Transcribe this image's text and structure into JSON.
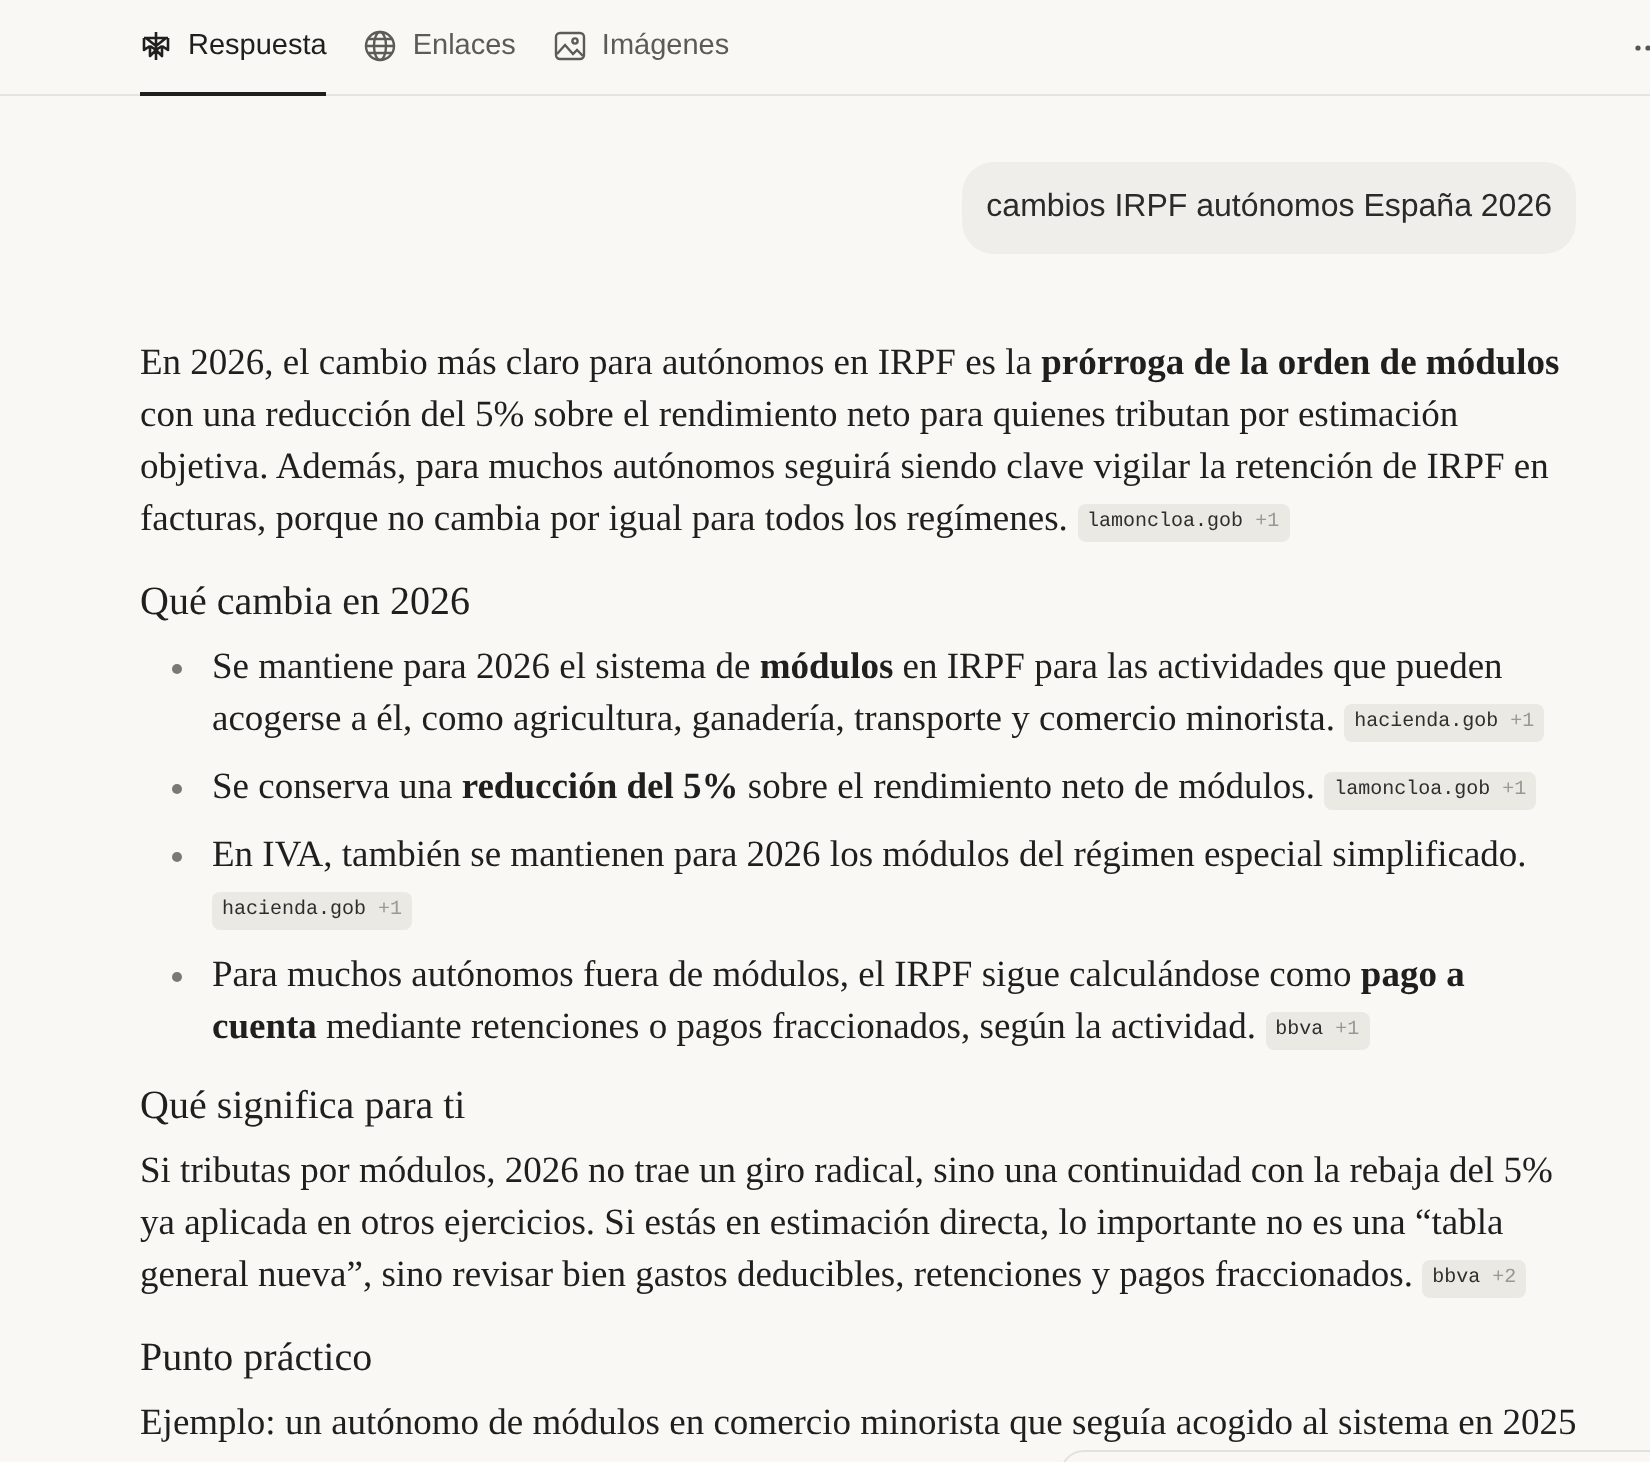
{
  "tabs": [
    {
      "label": "Respuesta",
      "selected": true
    },
    {
      "label": "Enlaces",
      "selected": false
    },
    {
      "label": "Imágenes",
      "selected": false
    }
  ],
  "query": {
    "text": "cambios IRPF autónomos España 2026"
  },
  "answer": [
    {
      "kind": "paragraph",
      "text": "En 2026, el cambio más claro para autónomos en IRPF es la **prórroga de la orden de módulos** con una reducción del 5% sobre el rendimiento neto para quienes tributan por estimación objetiva. Además, para muchos autónomos seguirá siendo clave vigilar la retención de IRPF en facturas, porque no cambia por igual para todos los regímenes.",
      "citation": {
        "source": "lamoncloa.gob",
        "count": "+1"
      }
    },
    {
      "kind": "heading",
      "text": "Qué cambia en 2026"
    },
    {
      "kind": "list",
      "items": [
        {
          "text": "Se mantiene para 2026 el sistema de **módulos** en IRPF para las actividades que pueden acogerse a él, como agricultura, ganadería, transporte y comercio minorista.",
          "citation": {
            "source": "hacienda.gob",
            "count": "+1"
          }
        },
        {
          "text": "Se conserva una **reducción del 5%** sobre el rendimiento neto de módulos.",
          "citation": {
            "source": "lamoncloa.gob",
            "count": "+1"
          }
        },
        {
          "text": "En IVA, también se mantienen para 2026 los módulos del régimen especial simplificado.",
          "citation": {
            "source": "hacienda.gob",
            "count": "+1"
          }
        },
        {
          "text": "Para muchos autónomos fuera de módulos, el IRPF sigue calculándose como **pago a cuenta** mediante retenciones o pagos fraccionados, según la actividad.",
          "citation": {
            "source": "bbva",
            "count": "+1"
          }
        }
      ]
    },
    {
      "kind": "heading",
      "text": "Qué significa para ti"
    },
    {
      "kind": "paragraph",
      "text": "Si tributas por módulos, 2026 no trae un giro radical, sino una continuidad con la rebaja del 5% ya aplicada en otros ejercicios. Si estás en estimación directa, lo importante no es una “tabla general nueva”, sino revisar bien gastos deducibles, retenciones y pagos fraccionados.",
      "citation": {
        "source": "bbva",
        "count": "+2"
      }
    },
    {
      "kind": "heading",
      "text": "Punto práctico"
    },
    {
      "kind": "paragraph",
      "text": "Ejemplo: un autónomo de módulos en comercio minorista que seguía acogido al sistema en 2025"
    }
  ]
}
